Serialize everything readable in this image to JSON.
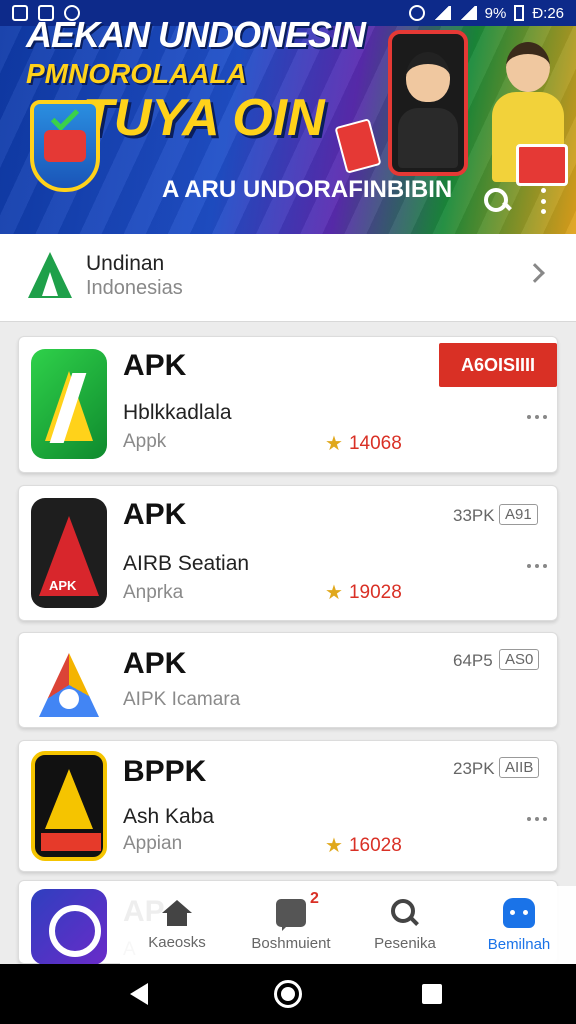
{
  "status_bar": {
    "battery": "9%",
    "time": "Ð:26"
  },
  "banner": {
    "headline": "AEKAN UNDONESIN",
    "subline": "PMNOROLAALA",
    "promo": "TUYA OIN",
    "app_title": "A ARU UNDORAFINBIBIN"
  },
  "category": {
    "title": "Undinan",
    "subtitle": "Indonesias"
  },
  "apps": [
    {
      "name": "APK",
      "developer": "Hblkkadlala",
      "category": "Appk",
      "rating": "14068",
      "install_label": "A6OISIIII"
    },
    {
      "name": "APK",
      "developer": "AIRB Seatian",
      "category": "Anprka",
      "rating": "19028",
      "size": "33PK",
      "badge": "A91"
    },
    {
      "name": "APK",
      "developer": "",
      "category": "AIPK Icamara",
      "size": "64P5",
      "badge": "AS0"
    },
    {
      "name": "BPPK",
      "developer": "Ash Kaba",
      "category": "Appian",
      "rating": "16028",
      "size": "23PK",
      "badge": "AIIB"
    },
    {
      "name": "AP",
      "developer": "",
      "category": "A"
    }
  ],
  "bottom_nav": [
    {
      "label": "Kaeosks",
      "icon": "home-icon"
    },
    {
      "label": "Boshmuient",
      "icon": "chat-icon",
      "badge": "2"
    },
    {
      "label": "Pesenika",
      "icon": "search-icon"
    },
    {
      "label": "Bemilnah",
      "icon": "robot-icon"
    }
  ],
  "colors": {
    "header": "#0d2a8a",
    "accent": "#d93025",
    "active": "#1a73e8"
  }
}
